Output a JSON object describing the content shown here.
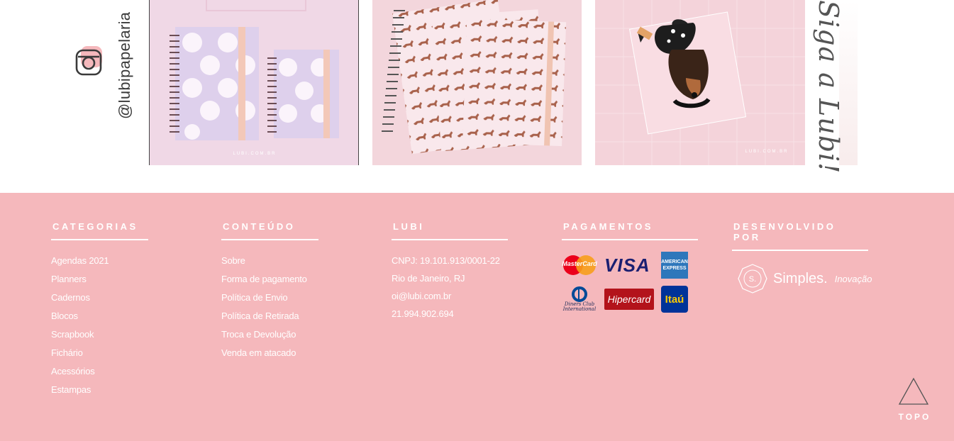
{
  "instagram": {
    "handle": "@lubipapelaria",
    "photos": [
      {
        "watermark": "LUBI.COM.BR"
      },
      {
        "watermark": ""
      },
      {
        "watermark": "LUBI.COM.BR"
      }
    ],
    "siga_text": "Siga a Lubi!"
  },
  "footer": {
    "colors": {
      "background": "#f5b8bc",
      "text": "#ffffff"
    },
    "categorias": {
      "title": "CATEGORIAS",
      "items": [
        "Agendas 2021",
        "Planners",
        "Cadernos",
        "Blocos",
        "Scrapbook",
        "Fichário",
        "Acessórios",
        "Estampas"
      ]
    },
    "conteudo": {
      "title": "CONTEÚDO",
      "items": [
        "Sobre",
        "Forma de pagamento",
        "Política de Envio",
        "Política de Retirada",
        "Troca e Devolução",
        "Venda em atacado"
      ]
    },
    "lubi": {
      "title": "LUBI",
      "cnpj": "CNPJ: 19.101.913/0001-22",
      "location": "Rio de Janeiro, RJ",
      "email": "oi@lubi.com.br",
      "phone": "21.994.902.694"
    },
    "pagamentos": {
      "title": "PAGAMENTOS",
      "cards": [
        {
          "name": "MasterCard",
          "icon": "mastercard-icon"
        },
        {
          "name": "VISA",
          "icon": "visa-icon"
        },
        {
          "name": "AMERICAN EXPRESS",
          "icon": "amex-icon"
        },
        {
          "name": "Diners Club International",
          "icon": "diners-icon"
        },
        {
          "name": "Hipercard",
          "icon": "hipercard-icon"
        },
        {
          "name": "Itaú",
          "icon": "itau-icon"
        }
      ]
    },
    "desenvolvido": {
      "title": "DESENVOLVIDO POR",
      "badge": "S.",
      "name": "Simples.",
      "sub": "Inovação"
    },
    "topo": {
      "label": "TOPO"
    }
  }
}
